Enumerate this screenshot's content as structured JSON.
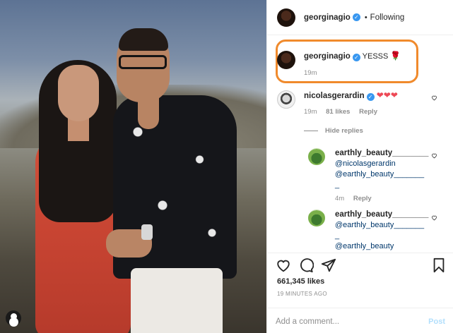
{
  "header": {
    "username": "georginagio",
    "separator": "•",
    "follow_status": "Following"
  },
  "caption": {
    "username": "georginagio",
    "text": "YESSS",
    "emoji": "🌹",
    "time": "19m"
  },
  "comments": [
    {
      "username": "nicolasgerardin",
      "hearts": "❤❤❤",
      "time": "19m",
      "likes": "81 likes",
      "reply": "Reply",
      "hide_replies": "Hide replies"
    }
  ],
  "replies": [
    {
      "username": "earthly_beauty________",
      "lines": [
        "@nicolasgerardin",
        "@earthly_beauty_______",
        "_"
      ],
      "time": "4m",
      "reply": "Reply"
    },
    {
      "username": "earthly_beauty________",
      "lines": [
        "@earthly_beauty_______",
        "_",
        "@earthly_beauty"
      ]
    }
  ],
  "footer": {
    "likes": "661,345 likes",
    "time": "19 MINUTES AGO",
    "comment_placeholder": "Add a comment...",
    "post_label": "Post"
  },
  "colors": {
    "highlight_box": "#f08a2c",
    "verified_badge": "#3897f0",
    "mention_link": "#00376b",
    "post_button_disabled": "#b2dffc",
    "heart_red": "#ed4956"
  },
  "icons": [
    "heart-icon",
    "comment-icon",
    "share-icon",
    "bookmark-icon",
    "verified-icon",
    "like-comment-icon",
    "user-tag-icon"
  ]
}
